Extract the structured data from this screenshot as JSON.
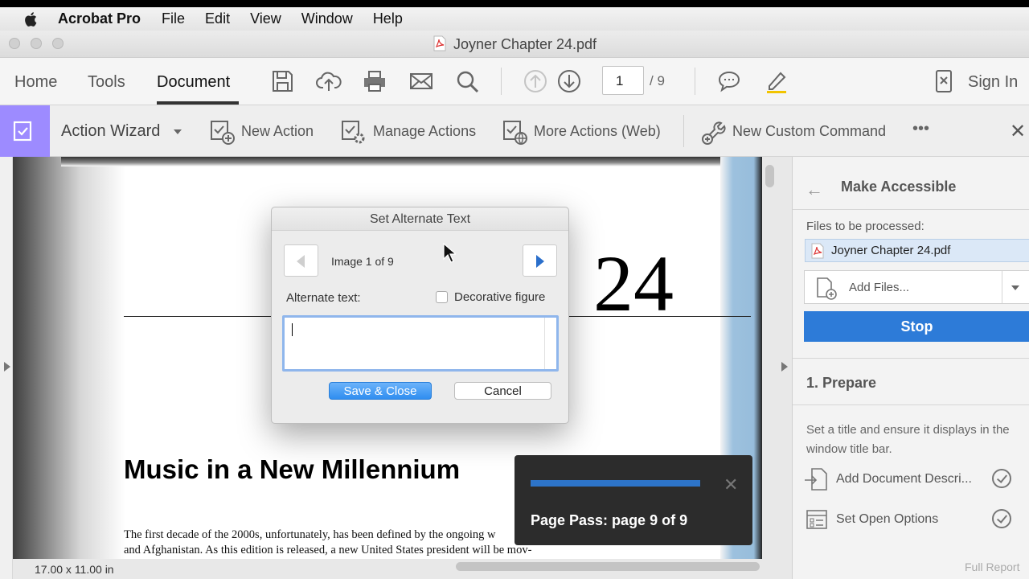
{
  "menubar": {
    "app_name": "Acrobat Pro",
    "items": [
      "File",
      "Edit",
      "View",
      "Window",
      "Help"
    ]
  },
  "window": {
    "title": "Joyner Chapter 24.pdf"
  },
  "toolbar": {
    "tabs": [
      {
        "label": "Home"
      },
      {
        "label": "Tools"
      },
      {
        "label": "Document",
        "active": true
      }
    ],
    "page_current": "1",
    "page_total": "/ 9",
    "sign_in": "Sign In",
    "icons": [
      "save-icon",
      "upload-icon",
      "print-icon",
      "email-icon",
      "search-icon",
      "page-up-icon",
      "page-down-icon",
      "comment-icon",
      "highlight-icon",
      "mobile-icon"
    ]
  },
  "action_bar": {
    "label": "Action Wizard",
    "items": [
      {
        "label": "New Action",
        "icon": "new-action-icon"
      },
      {
        "label": "Manage Actions",
        "icon": "manage-actions-icon"
      },
      {
        "label": "More Actions (Web)",
        "icon": "more-actions-web-icon"
      },
      {
        "label": "New Custom Command",
        "icon": "new-custom-command-icon"
      }
    ],
    "more": "•••",
    "close": "✕"
  },
  "document": {
    "chapter_number": "24",
    "chapter_title": "Music in a New Millennium",
    "body_lines": [
      "The first decade of the 2000s, unfortunately, has been defined by the ongoing w",
      "and Afghanistan. As this edition is released, a new United States president will be mov-"
    ],
    "status": "17.00 x 11.00 in"
  },
  "right_panel": {
    "title": "Make Accessible",
    "files_label": "Files to be processed:",
    "file_name": "Joyner Chapter 24.pdf",
    "add_files": "Add Files...",
    "stop": "Stop",
    "section": "1. Prepare",
    "description": "Set a title and ensure it displays in the window title bar.",
    "steps": [
      {
        "label": "Add Document Descri...",
        "icon": "add-description-icon"
      },
      {
        "label": "Set Open Options",
        "icon": "open-options-icon"
      }
    ],
    "full_report": "Full Report"
  },
  "dialog": {
    "title": "Set Alternate Text",
    "image_count": "Image 1 of 9",
    "alt_label": "Alternate text:",
    "decorative_label": "Decorative figure",
    "alt_value": "",
    "save": "Save & Close",
    "cancel": "Cancel"
  },
  "toast": {
    "message": "Page Pass: page 9 of 9",
    "progress": 1.0,
    "close": "✕"
  },
  "colors": {
    "accent": "#2d7bd8",
    "tool_highlight": "#9d8bff",
    "toast_bg": "#2c2c2c"
  }
}
